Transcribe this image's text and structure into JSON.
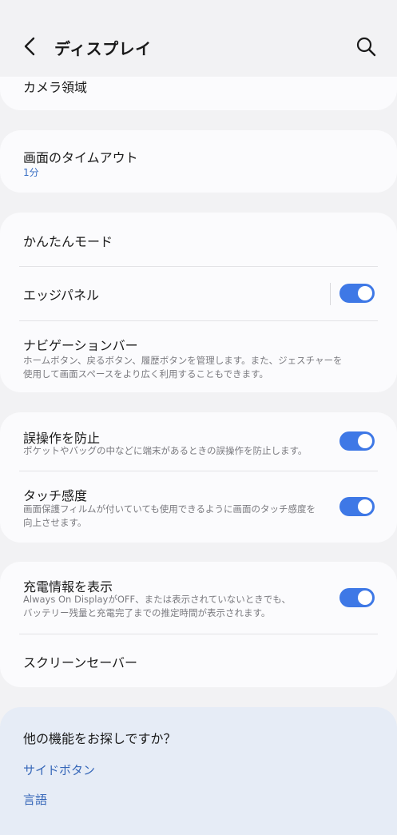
{
  "header": {
    "title": "ディスプレイ"
  },
  "camera_area": {
    "label": "カメラ領域"
  },
  "screen_timeout": {
    "label": "画面のタイムアウト",
    "value": "1分"
  },
  "easy_mode": {
    "label": "かんたんモード"
  },
  "edge_panel": {
    "label": "エッジパネル",
    "enabled": true
  },
  "navigation_bar": {
    "label": "ナビゲーションバー",
    "desc_line1": "ホームボタン、戻るボタン、履歴ボタンを管理します。また、ジェスチャーを",
    "desc_line2": "使用して画面スペースをより広く利用することもできます。"
  },
  "accidental_touch": {
    "label": "誤操作を防止",
    "desc": "ポケットやバッグの中などに端末があるときの誤操作を防止します。",
    "enabled": true
  },
  "touch_sensitivity": {
    "label": "タッチ感度",
    "desc_line1": "画面保護フィルムが付いていても使用できるように画面のタッチ感度を",
    "desc_line2": "向上させます。",
    "enabled": true
  },
  "charging_info": {
    "label": "充電情報を表示",
    "desc_line1": "Always On DisplayがOFF、または表示されていないときでも、",
    "desc_line2": "バッテリー残量と充電完了までの推定時間が表示されます。",
    "enabled": true
  },
  "screen_saver": {
    "label": "スクリーンセーバー"
  },
  "suggestions": {
    "title": "他の機能をお探しですか？",
    "links": [
      "サイドボタン",
      "言語"
    ]
  },
  "colors": {
    "accent": "#3e78e6",
    "link": "#3566b8"
  }
}
